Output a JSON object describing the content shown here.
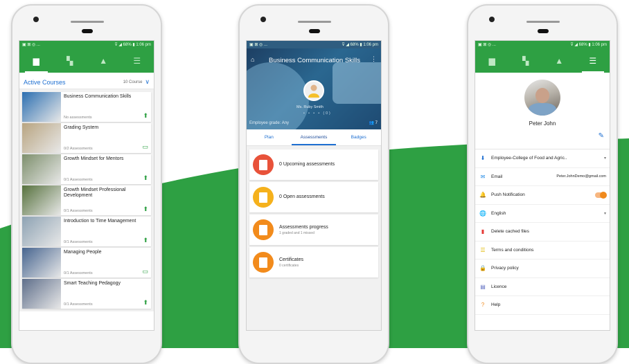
{
  "status": {
    "left": "▣ ⊠ ◎ ...",
    "right": "⊽ ◢ 68% ▮ 1:06 pm"
  },
  "nav_icons": [
    "book-icon",
    "chat-icon",
    "bell-icon",
    "menu-icon"
  ],
  "phone1": {
    "header": {
      "title": "Active Courses",
      "count": "10 Course"
    },
    "courses": [
      {
        "title": "Business Communication Skills",
        "sub": "No assessments",
        "icon": "person-icon",
        "thumb": "#2c6fb1"
      },
      {
        "title": "Grading System",
        "sub": "0/2 Assessments",
        "icon": "monitor-icon",
        "thumb": "#b8a480"
      },
      {
        "title": "Growth Mindset for Mentors",
        "sub": "0/1 Assessments",
        "icon": "person-icon",
        "thumb": "#7d8f6c"
      },
      {
        "title": "Growth Mindset Professional Development",
        "sub": "0/1 Assessments",
        "icon": "person-icon",
        "thumb": "#56713d"
      },
      {
        "title": "Introduction to Time Management",
        "sub": "0/1 Assessments",
        "icon": "person-icon",
        "thumb": "#8da2b3"
      },
      {
        "title": "Managing People",
        "sub": "0/1 Assessments",
        "icon": "monitor-icon",
        "thumb": "#46648f"
      },
      {
        "title": "Smart Teaching Pedagogy",
        "sub": "0/1 Assessments",
        "icon": "person-icon",
        "thumb": "#5e6e8a"
      }
    ]
  },
  "phone2": {
    "hero": {
      "title": "Business Communication Skills",
      "teacher": "Ms. Ruby Smith",
      "grade": "Employee grade: Any",
      "members": "7",
      "dots": "• • • • (0)"
    },
    "tabs": [
      "Plan",
      "Assessments",
      "Badges"
    ],
    "active_tab": "Assessments",
    "cards": [
      {
        "title": "0 Upcoming assessments",
        "sub": "",
        "color": "#e8523a"
      },
      {
        "title": "0 Open assessments",
        "sub": "",
        "color": "#f5b11c"
      },
      {
        "title": "Assessments progress",
        "sub": "1 graded and 1 missed",
        "color": "#f28b1c"
      },
      {
        "title": "Certificates",
        "sub": "0 certificates",
        "color": "#f28b1c"
      }
    ]
  },
  "phone3": {
    "name": "Peter John",
    "rows": [
      {
        "icon": "person-pin-icon",
        "glyph": "⬇",
        "color": "#1e6fd1",
        "label": "Employee-College of Food and Agric..",
        "value": "",
        "caret": "▾"
      },
      {
        "icon": "mail-icon",
        "glyph": "✉",
        "color": "#1e88e5",
        "label": "Email",
        "value": "Peter.JohnDemo@gmail.com",
        "caret": ""
      },
      {
        "icon": "bell-icon",
        "glyph": "🔔",
        "color": "#f08a1c",
        "label": "Push Notification",
        "value": "",
        "caret": ""
      },
      {
        "icon": "globe-icon",
        "glyph": "🌐",
        "color": "#1e6fd1",
        "label": "English",
        "value": "",
        "caret": "▾"
      },
      {
        "icon": "trash-icon",
        "glyph": "▮",
        "color": "#e53935",
        "label": "Delete cached files",
        "value": "",
        "caret": ""
      },
      {
        "icon": "list-icon",
        "glyph": "☰",
        "color": "#e0b800",
        "label": "Terms and conditions",
        "value": "",
        "caret": ""
      },
      {
        "icon": "lock-icon",
        "glyph": "🔒",
        "color": "#9e9e9e",
        "label": "Privacy policy",
        "value": "",
        "caret": ""
      },
      {
        "icon": "licence-icon",
        "glyph": "▤",
        "color": "#5c6bc0",
        "label": "Licence",
        "value": "",
        "caret": ""
      },
      {
        "icon": "help-icon",
        "glyph": "?",
        "color": "#f08a1c",
        "label": "Help",
        "value": "",
        "caret": ""
      }
    ]
  },
  "colors": {
    "green": "#2ea043",
    "blue": "#1e6fd1"
  }
}
